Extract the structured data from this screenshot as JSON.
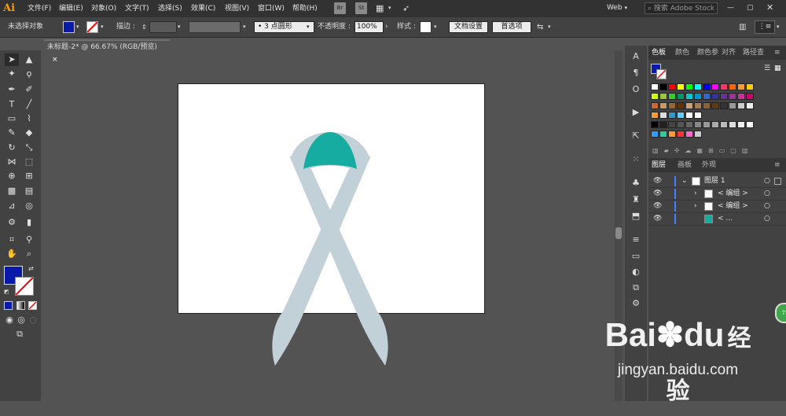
{
  "app": {
    "logo": "Ai"
  },
  "menu": {
    "items": [
      "文件(F)",
      "编辑(E)",
      "对象(O)",
      "文字(T)",
      "选择(S)",
      "效果(C)",
      "视图(V)",
      "窗口(W)",
      "帮助(H)"
    ]
  },
  "titlebar": {
    "br_label": "Br",
    "st_label": "St",
    "workspace": "Web",
    "search_placeholder": "搜索 Adobe Stock"
  },
  "control": {
    "selection_status": "未选择对象",
    "stroke_label": "描边 :",
    "brush_label": "3 点圆形",
    "opacity_label": "不透明度 :",
    "opacity_value": "100%",
    "style_label": "样式 :",
    "doc_setup_button": "文档设置",
    "prefs_button": "首选项"
  },
  "document": {
    "tab_title": "未标题-2* @ 66.67% (RGB/预览)",
    "close": "×"
  },
  "panels": {
    "top_tabs": [
      "色板",
      "颜色",
      "颜色参",
      "对齐",
      "路径查"
    ],
    "layer_tabs": [
      "图层",
      "画板",
      "外观"
    ],
    "layers": [
      {
        "name": "图层 1"
      },
      {
        "name": "< 编组 >"
      },
      {
        "name": "< 编组 >"
      },
      {
        "name": "< ..."
      }
    ]
  },
  "colors": {
    "fill": "#0a1aa8",
    "ribbon": "#c2d0d8",
    "teal": "#16aca2",
    "accent": "#ff9a00"
  },
  "watermark": {
    "brand": "Bai",
    "brand2": "du",
    "cn": "经验",
    "url": "jingyan.baidu.com"
  },
  "badge": {
    "text": "72"
  }
}
